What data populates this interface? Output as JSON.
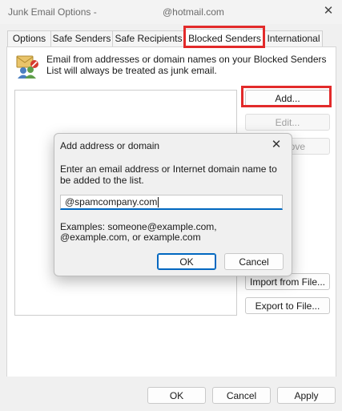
{
  "window": {
    "title_left": "Junk Email Options -",
    "title_right": "@hotmail.com",
    "close_glyph": "✕"
  },
  "tabs": [
    {
      "label": "Options",
      "selected": false
    },
    {
      "label": "Safe Senders",
      "selected": false
    },
    {
      "label": "Safe Recipients",
      "selected": false
    },
    {
      "label": "Blocked Senders",
      "selected": true
    },
    {
      "label": "International",
      "selected": false
    }
  ],
  "blocked_senders": {
    "icon": "blocked-senders-icon",
    "description": "Email from addresses or domain names on your Blocked Senders List will always be treated as junk email.",
    "buttons": {
      "add": "Add...",
      "edit": "Edit...",
      "remove": "ove",
      "import": "Import from File...",
      "export": "Export to File..."
    }
  },
  "dialog": {
    "title": "Add address or domain",
    "close_glyph": "✕",
    "prompt": "Enter an email address or Internet domain name to be added to the list.",
    "input_value": "@spamcompany.com",
    "examples": "Examples: someone@example.com, @example.com, or example.com",
    "ok": "OK",
    "cancel": "Cancel"
  },
  "footer": {
    "ok": "OK",
    "cancel": "Cancel",
    "apply": "Apply"
  },
  "colors": {
    "highlight": "#e22a2a",
    "accent": "#0067c0"
  }
}
